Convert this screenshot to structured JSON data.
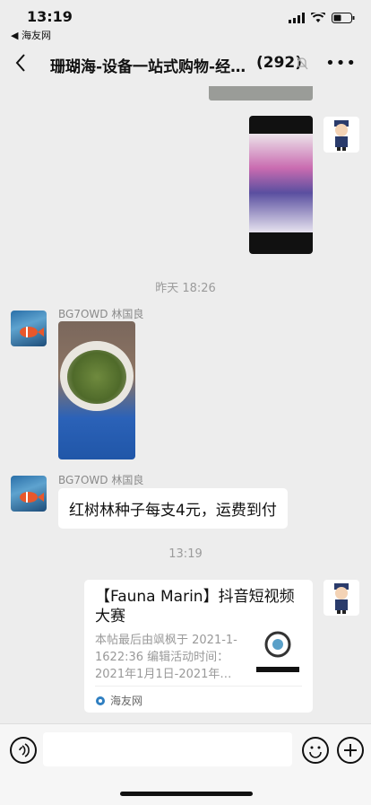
{
  "status": {
    "time": "13:19",
    "back_app": "◀ 海友网"
  },
  "nav": {
    "title": "珊瑚海-设备一站式购物-经营…",
    "count": "(292)"
  },
  "messages": {
    "ts1": "昨天 18:26",
    "sender1": "BG7OWD 林国良",
    "sender2": "BG7OWD 林国良",
    "text2": "红树林种子每支4元，运费到付",
    "ts2": "13:19",
    "card": {
      "title": "【Fauna Marin】抖音短视频大赛",
      "desc": "本帖最后由飒枫于 2021-1-1622:36 编辑活动时间：2021年1月1日-2021年…",
      "source": "海友网"
    }
  }
}
